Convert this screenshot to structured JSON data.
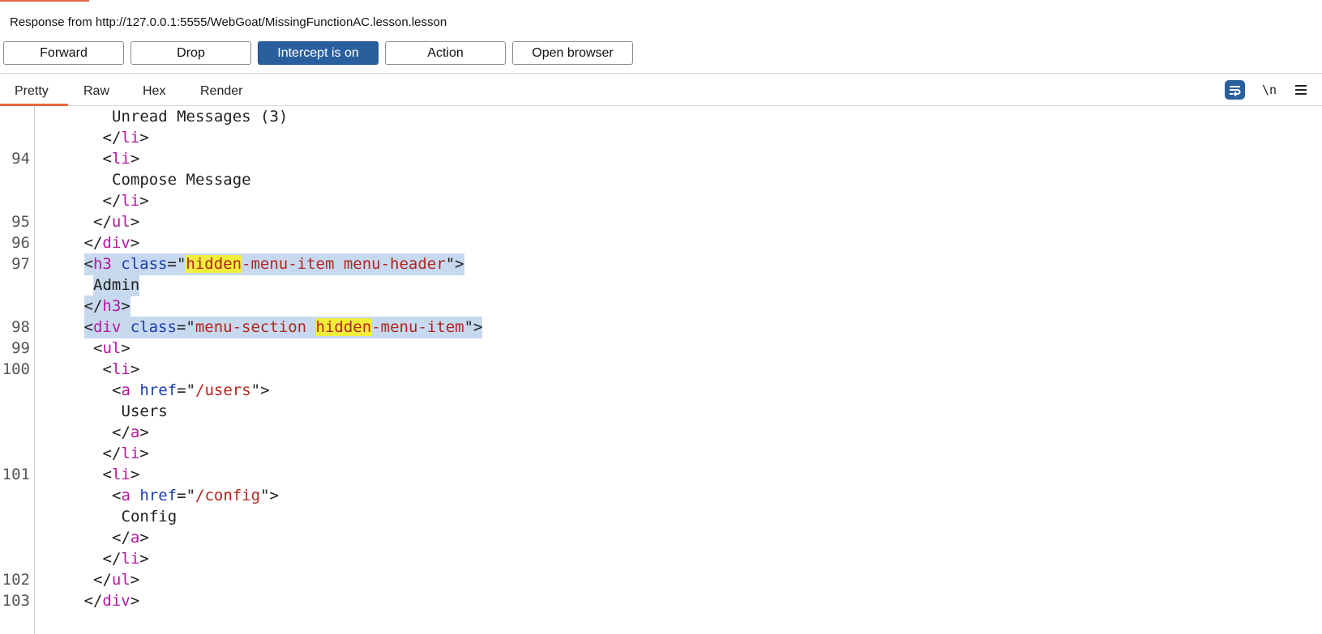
{
  "header": {
    "title": "Response from http://127.0.0.1:5555/WebGoat/MissingFunctionAC.lesson.lesson"
  },
  "toolbar": {
    "forward": "Forward",
    "drop": "Drop",
    "intercept": "Intercept is on",
    "action": "Action",
    "open_browser": "Open browser"
  },
  "tabs": {
    "pretty": "Pretty",
    "raw": "Raw",
    "hex": "Hex",
    "render": "Render",
    "selected": "Pretty"
  },
  "tools": {
    "wrap_icon": "wrap-lines-icon",
    "newline_label": "\\n",
    "menu_icon": "hamburger-menu-icon"
  },
  "colors": {
    "accent": "#e8673c",
    "intercept_bg": "#2a5f9e",
    "selection": "#c7d9ef",
    "search_match": "#f2ef3a",
    "tag": "#b5179e",
    "attr": "#1c3fb0",
    "string": "#b3261e"
  },
  "code_lines": [
    {
      "num": "",
      "indent": 10,
      "hl": false,
      "tokens": [
        {
          "t": "text",
          "v": "Unread Messages (3)"
        }
      ]
    },
    {
      "num": "",
      "indent": 9,
      "hl": false,
      "tokens": [
        {
          "t": "p",
          "v": "</"
        },
        {
          "t": "tag",
          "v": "li"
        },
        {
          "t": "p",
          "v": ">"
        }
      ]
    },
    {
      "num": "94",
      "indent": 9,
      "hl": false,
      "tokens": [
        {
          "t": "p",
          "v": "<"
        },
        {
          "t": "tag",
          "v": "li"
        },
        {
          "t": "p",
          "v": ">"
        }
      ]
    },
    {
      "num": "",
      "indent": 10,
      "hl": false,
      "tokens": [
        {
          "t": "text",
          "v": "Compose Message"
        }
      ]
    },
    {
      "num": "",
      "indent": 9,
      "hl": false,
      "tokens": [
        {
          "t": "p",
          "v": "</"
        },
        {
          "t": "tag",
          "v": "li"
        },
        {
          "t": "p",
          "v": ">"
        }
      ]
    },
    {
      "num": "95",
      "indent": 8,
      "hl": false,
      "tokens": [
        {
          "t": "p",
          "v": "</"
        },
        {
          "t": "tag",
          "v": "ul"
        },
        {
          "t": "p",
          "v": ">"
        }
      ]
    },
    {
      "num": "96",
      "indent": 7,
      "hl": false,
      "tokens": [
        {
          "t": "p",
          "v": "</"
        },
        {
          "t": "tag",
          "v": "div"
        },
        {
          "t": "p",
          "v": ">"
        }
      ]
    },
    {
      "num": "97",
      "indent": 7,
      "hl": true,
      "tokens": [
        {
          "t": "p",
          "v": "<"
        },
        {
          "t": "tag",
          "v": "h3"
        },
        {
          "t": "p",
          "v": " "
        },
        {
          "t": "attr",
          "v": "class"
        },
        {
          "t": "p",
          "v": "=\""
        },
        {
          "t": "mark",
          "v": "hidden"
        },
        {
          "t": "str",
          "v": "-menu-item menu-header"
        },
        {
          "t": "p",
          "v": "\">"
        }
      ]
    },
    {
      "num": "",
      "indent": 8,
      "hl": true,
      "tokens": [
        {
          "t": "text",
          "v": "Admin"
        }
      ]
    },
    {
      "num": "",
      "indent": 7,
      "hl": true,
      "tokens": [
        {
          "t": "p",
          "v": "</"
        },
        {
          "t": "tag",
          "v": "h3"
        },
        {
          "t": "p",
          "v": ">"
        }
      ]
    },
    {
      "num": "98",
      "indent": 7,
      "hl": true,
      "tokens": [
        {
          "t": "p",
          "v": "<"
        },
        {
          "t": "tag",
          "v": "div"
        },
        {
          "t": "p",
          "v": " "
        },
        {
          "t": "attr",
          "v": "class"
        },
        {
          "t": "p",
          "v": "=\""
        },
        {
          "t": "str",
          "v": "menu-section "
        },
        {
          "t": "mark",
          "v": "hidden"
        },
        {
          "t": "str",
          "v": "-menu-item"
        },
        {
          "t": "p",
          "v": "\">"
        }
      ]
    },
    {
      "num": "99",
      "indent": 8,
      "hl": false,
      "tokens": [
        {
          "t": "p",
          "v": "<"
        },
        {
          "t": "tag",
          "v": "ul"
        },
        {
          "t": "p",
          "v": ">"
        }
      ]
    },
    {
      "num": "100",
      "indent": 9,
      "hl": false,
      "tokens": [
        {
          "t": "p",
          "v": "<"
        },
        {
          "t": "tag",
          "v": "li"
        },
        {
          "t": "p",
          "v": ">"
        }
      ]
    },
    {
      "num": "",
      "indent": 10,
      "hl": false,
      "tokens": [
        {
          "t": "p",
          "v": "<"
        },
        {
          "t": "tag",
          "v": "a"
        },
        {
          "t": "p",
          "v": " "
        },
        {
          "t": "attr",
          "v": "href"
        },
        {
          "t": "p",
          "v": "=\""
        },
        {
          "t": "str",
          "v": "/users"
        },
        {
          "t": "p",
          "v": "\">"
        }
      ]
    },
    {
      "num": "",
      "indent": 11,
      "hl": false,
      "tokens": [
        {
          "t": "text",
          "v": "Users"
        }
      ]
    },
    {
      "num": "",
      "indent": 10,
      "hl": false,
      "tokens": [
        {
          "t": "p",
          "v": "</"
        },
        {
          "t": "tag",
          "v": "a"
        },
        {
          "t": "p",
          "v": ">"
        }
      ]
    },
    {
      "num": "",
      "indent": 9,
      "hl": false,
      "tokens": [
        {
          "t": "p",
          "v": "</"
        },
        {
          "t": "tag",
          "v": "li"
        },
        {
          "t": "p",
          "v": ">"
        }
      ]
    },
    {
      "num": "101",
      "indent": 9,
      "hl": false,
      "tokens": [
        {
          "t": "p",
          "v": "<"
        },
        {
          "t": "tag",
          "v": "li"
        },
        {
          "t": "p",
          "v": ">"
        }
      ]
    },
    {
      "num": "",
      "indent": 10,
      "hl": false,
      "tokens": [
        {
          "t": "p",
          "v": "<"
        },
        {
          "t": "tag",
          "v": "a"
        },
        {
          "t": "p",
          "v": " "
        },
        {
          "t": "attr",
          "v": "href"
        },
        {
          "t": "p",
          "v": "=\""
        },
        {
          "t": "str",
          "v": "/config"
        },
        {
          "t": "p",
          "v": "\">"
        }
      ]
    },
    {
      "num": "",
      "indent": 11,
      "hl": false,
      "tokens": [
        {
          "t": "text",
          "v": "Config"
        }
      ]
    },
    {
      "num": "",
      "indent": 10,
      "hl": false,
      "tokens": [
        {
          "t": "p",
          "v": "</"
        },
        {
          "t": "tag",
          "v": "a"
        },
        {
          "t": "p",
          "v": ">"
        }
      ]
    },
    {
      "num": "",
      "indent": 9,
      "hl": false,
      "tokens": [
        {
          "t": "p",
          "v": "</"
        },
        {
          "t": "tag",
          "v": "li"
        },
        {
          "t": "p",
          "v": ">"
        }
      ]
    },
    {
      "num": "102",
      "indent": 8,
      "hl": false,
      "tokens": [
        {
          "t": "p",
          "v": "</"
        },
        {
          "t": "tag",
          "v": "ul"
        },
        {
          "t": "p",
          "v": ">"
        }
      ]
    },
    {
      "num": "103",
      "indent": 7,
      "hl": false,
      "tokens": [
        {
          "t": "p",
          "v": "</"
        },
        {
          "t": "tag",
          "v": "div"
        },
        {
          "t": "p",
          "v": ">"
        }
      ]
    }
  ]
}
